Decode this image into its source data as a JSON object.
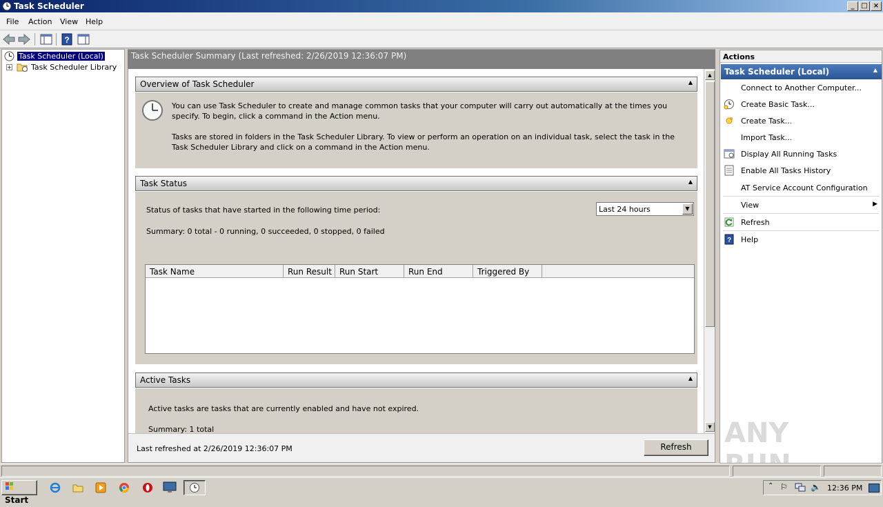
{
  "window": {
    "title": "Task Scheduler",
    "min_glyph": "_",
    "max_glyph": "□",
    "close_glyph": "×"
  },
  "menu": [
    "File",
    "Action",
    "View",
    "Help"
  ],
  "tree": {
    "root": "Task Scheduler (Local)",
    "child": "Task Scheduler Library",
    "expander": "+"
  },
  "summary": {
    "header": "Task Scheduler Summary (Last refreshed: 2/26/2019 12:36:07 PM)"
  },
  "overview": {
    "title": "Overview of Task Scheduler",
    "para1": "You can use Task Scheduler to create and manage common tasks that your computer will carry out automatically at the times you specify. To begin, click a command in the Action menu.",
    "para2": "Tasks are stored in folders in the Task Scheduler Library. To view or perform an operation on an individual task, select the task in the Task Scheduler Library and click on a command in the Action menu."
  },
  "task_status": {
    "title": "Task Status",
    "period_label": "Status of tasks that have started in the following time period:",
    "period_value": "Last 24 hours",
    "summary": "Summary: 0 total - 0 running, 0 succeeded, 0 stopped, 0 failed",
    "columns": [
      "Task Name",
      "Run Result",
      "Run Start",
      "Run End",
      "Triggered By"
    ]
  },
  "active_tasks": {
    "title": "Active Tasks",
    "description": "Active tasks are tasks that are currently enabled and have not expired.",
    "summary": "Summary: 1 total"
  },
  "footer": {
    "last_refreshed": "Last refreshed at 2/26/2019 12:36:07 PM",
    "refresh_button": "Refresh"
  },
  "actions": {
    "header": "Actions",
    "section": "Task Scheduler (Local)",
    "items": [
      {
        "label": "Connect to Another Computer...",
        "icon": "none"
      },
      {
        "label": "Create Basic Task...",
        "icon": "basic-task-icon"
      },
      {
        "label": "Create Task...",
        "icon": "create-task-icon"
      },
      {
        "label": "Import Task...",
        "icon": "none"
      },
      {
        "label": "Display All Running Tasks",
        "icon": "running-tasks-icon"
      },
      {
        "label": "Enable All Tasks History",
        "icon": "history-icon"
      },
      {
        "label": "AT Service Account Configuration",
        "icon": "none"
      },
      {
        "label": "View",
        "icon": "none"
      },
      {
        "label": "Refresh",
        "icon": "refresh-icon"
      },
      {
        "label": "Help",
        "icon": "help-icon"
      }
    ]
  },
  "taskbar": {
    "start": "Start",
    "clock": "12:36 PM"
  },
  "watermark": "ANY RUN"
}
